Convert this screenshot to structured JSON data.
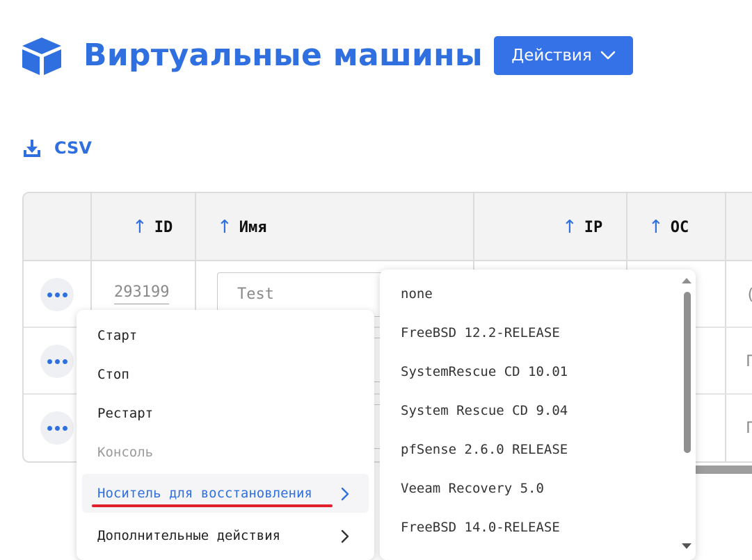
{
  "header": {
    "title": "Виртуальные машины",
    "actions_label": "Действия"
  },
  "csv": {
    "label": "CSV"
  },
  "table": {
    "columns": [
      {
        "label": "ID",
        "arrow": "↑"
      },
      {
        "label": "Имя",
        "arrow": "↑"
      },
      {
        "label": "IP",
        "arrow": "↑"
      },
      {
        "label": "ОС",
        "arrow": "↑"
      }
    ],
    "rows": [
      {
        "id": "293199",
        "name_placeholder": "Test"
      }
    ]
  },
  "context_menu": {
    "items": [
      {
        "label": "Старт",
        "state": "normal"
      },
      {
        "label": "Стоп",
        "state": "normal"
      },
      {
        "label": "Рестарт",
        "state": "normal"
      },
      {
        "label": "Консоль",
        "state": "disabled"
      },
      {
        "label": "Носитель для восстановления",
        "state": "active"
      },
      {
        "label": "Дополнительные действия",
        "state": "normal"
      }
    ]
  },
  "submenu": {
    "items": [
      "none",
      "FreeBSD 12.2-RELEASE",
      "SystemRescue CD 10.01",
      "System Rescue CD 9.04",
      "pfSense 2.6.0 RELEASE",
      "Veeam Recovery 5.0",
      "FreeBSD 14.0-RELEASE"
    ]
  },
  "colors": {
    "accent": "#2f6fe0",
    "button": "#3572e8",
    "highlight_underline": "#e0202a"
  }
}
